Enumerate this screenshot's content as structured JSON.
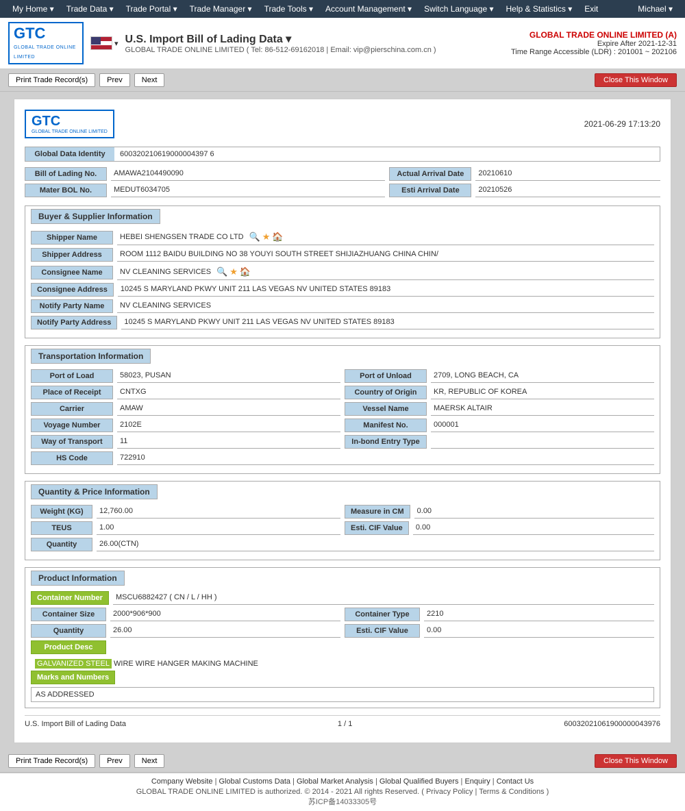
{
  "nav": {
    "items": [
      {
        "label": "My Home ▾",
        "id": "my-home"
      },
      {
        "label": "Trade Data ▾",
        "id": "trade-data"
      },
      {
        "label": "Trade Portal ▾",
        "id": "trade-portal"
      },
      {
        "label": "Trade Manager ▾",
        "id": "trade-manager"
      },
      {
        "label": "Trade Tools ▾",
        "id": "trade-tools"
      },
      {
        "label": "Account Management ▾",
        "id": "account-mgmt"
      },
      {
        "label": "Switch Language ▾",
        "id": "switch-lang"
      },
      {
        "label": "Help & Statistics ▾",
        "id": "help-stats"
      },
      {
        "label": "Exit",
        "id": "exit"
      }
    ],
    "user": "Michael ▾"
  },
  "header": {
    "logo_main": "GTC",
    "logo_sub": "GLOBAL TRADE ONLINE LIMITED",
    "flag_alt": "US Flag",
    "page_title": "U.S. Import Bill of Lading Data ▾",
    "page_subtitle": "GLOBAL TRADE ONLINE LIMITED ( Tel: 86-512-69162018  |  Email: vip@pierschina.com.cn  )",
    "account_name": "GLOBAL TRADE ONLINE LIMITED (A)",
    "expire_label": "Expire After 2021-12-31",
    "range_label": "Time Range Accessible (LDR) : 201001 ~ 202106"
  },
  "toolbar": {
    "print_label": "Print Trade Record(s)",
    "prev_label": "Prev",
    "next_label": "Next",
    "close_label": "Close This Window",
    "print_bottom_label": "Print Trade Record(s)",
    "prev_bottom_label": "Prev",
    "next_bottom_label": "Next",
    "close_bottom_label": "Close This Window"
  },
  "record": {
    "logo_main": "GTC",
    "logo_sub": "GLOBAL TRADE ONLINE LIMITED",
    "date": "2021-06-29 17:13:20",
    "global_data_identity_label": "Global Data Identity",
    "global_data_identity_value": "600320210619000004397 6",
    "bill_of_lading_label": "Bill of Lading No.",
    "bill_of_lading_value": "AMAWA2104490090",
    "actual_arrival_label": "Actual Arrival Date",
    "actual_arrival_value": "20210610",
    "mater_bol_label": "Mater BOL No.",
    "mater_bol_value": "MEDUT6034705",
    "esti_arrival_label": "Esti Arrival Date",
    "esti_arrival_value": "20210526"
  },
  "buyer_supplier": {
    "section_title": "Buyer & Supplier Information",
    "shipper_name_label": "Shipper Name",
    "shipper_name_value": "HEBEI SHENGSEN TRADE CO LTD",
    "shipper_address_label": "Shipper Address",
    "shipper_address_value": "ROOM 1112 BAIDU BUILDING NO 38 YOUYI SOUTH STREET SHIJIAZHUANG CHINA CHIN/",
    "consignee_name_label": "Consignee Name",
    "consignee_name_value": "NV CLEANING SERVICES",
    "consignee_address_label": "Consignee Address",
    "consignee_address_value": "10245 S MARYLAND PKWY UNIT 211 LAS VEGAS NV UNITED STATES 89183",
    "notify_party_name_label": "Notify Party Name",
    "notify_party_name_value": "NV CLEANING SERVICES",
    "notify_party_address_label": "Notify Party Address",
    "notify_party_address_value": "10245 S MARYLAND PKWY UNIT 211 LAS VEGAS NV UNITED STATES 89183"
  },
  "transportation": {
    "section_title": "Transportation Information",
    "port_of_load_label": "Port of Load",
    "port_of_load_value": "58023, PUSAN",
    "port_of_unload_label": "Port of Unload",
    "port_of_unload_value": "2709, LONG BEACH, CA",
    "place_of_receipt_label": "Place of Receipt",
    "place_of_receipt_value": "CNTXG",
    "country_of_origin_label": "Country of Origin",
    "country_of_origin_value": "KR, REPUBLIC OF KOREA",
    "carrier_label": "Carrier",
    "carrier_value": "AMAW",
    "vessel_name_label": "Vessel Name",
    "vessel_name_value": "MAERSK ALTAIR",
    "voyage_number_label": "Voyage Number",
    "voyage_number_value": "2102E",
    "manifest_no_label": "Manifest No.",
    "manifest_no_value": "000001",
    "way_of_transport_label": "Way of Transport",
    "way_of_transport_value": "11",
    "inbond_entry_label": "In-bond Entry Type",
    "inbond_entry_value": "",
    "hs_code_label": "HS Code",
    "hs_code_value": "722910"
  },
  "quantity_price": {
    "section_title": "Quantity & Price Information",
    "weight_label": "Weight (KG)",
    "weight_value": "12,760.00",
    "measure_label": "Measure in CM",
    "measure_value": "0.00",
    "teus_label": "TEUS",
    "teus_value": "1.00",
    "esti_cif_label": "Esti. CIF Value",
    "esti_cif_value": "0.00",
    "quantity_label": "Quantity",
    "quantity_value": "26.00(CTN)"
  },
  "product": {
    "section_title": "Product Information",
    "container_number_label": "Container Number",
    "container_number_value": "MSCU6882427 ( CN / L / HH )",
    "container_size_label": "Container Size",
    "container_size_value": "2000*906*900",
    "container_type_label": "Container Type",
    "container_type_value": "2210",
    "quantity_label": "Quantity",
    "quantity_value": "26.00",
    "esti_cif_label": "Esti. CIF Value",
    "esti_cif_value": "0.00",
    "product_desc_label": "Product Desc",
    "product_desc_highlight": "GALVANIZED STEEL",
    "product_desc_rest": " WIRE WIRE HANGER MAKING MACHINE",
    "marks_label": "Marks and Numbers",
    "marks_value": "AS ADDRESSED"
  },
  "pagination": {
    "record_title": "U.S. Import Bill of Lading Data",
    "page_info": "1 / 1",
    "record_id": "60032021061900000043976"
  },
  "footer": {
    "company_website": "Company Website",
    "global_customs": "Global Customs Data",
    "global_market": "Global Market Analysis",
    "global_qualified": "Global Qualified Buyers",
    "enquiry": "Enquiry",
    "contact_us": "Contact Us",
    "copyright": "GLOBAL TRADE ONLINE LIMITED is authorized. © 2014 - 2021 All rights Reserved.",
    "privacy_policy": "Privacy Policy",
    "terms_conditions": "Terms & Conditions",
    "icp": "苏ICP备14033305号"
  }
}
